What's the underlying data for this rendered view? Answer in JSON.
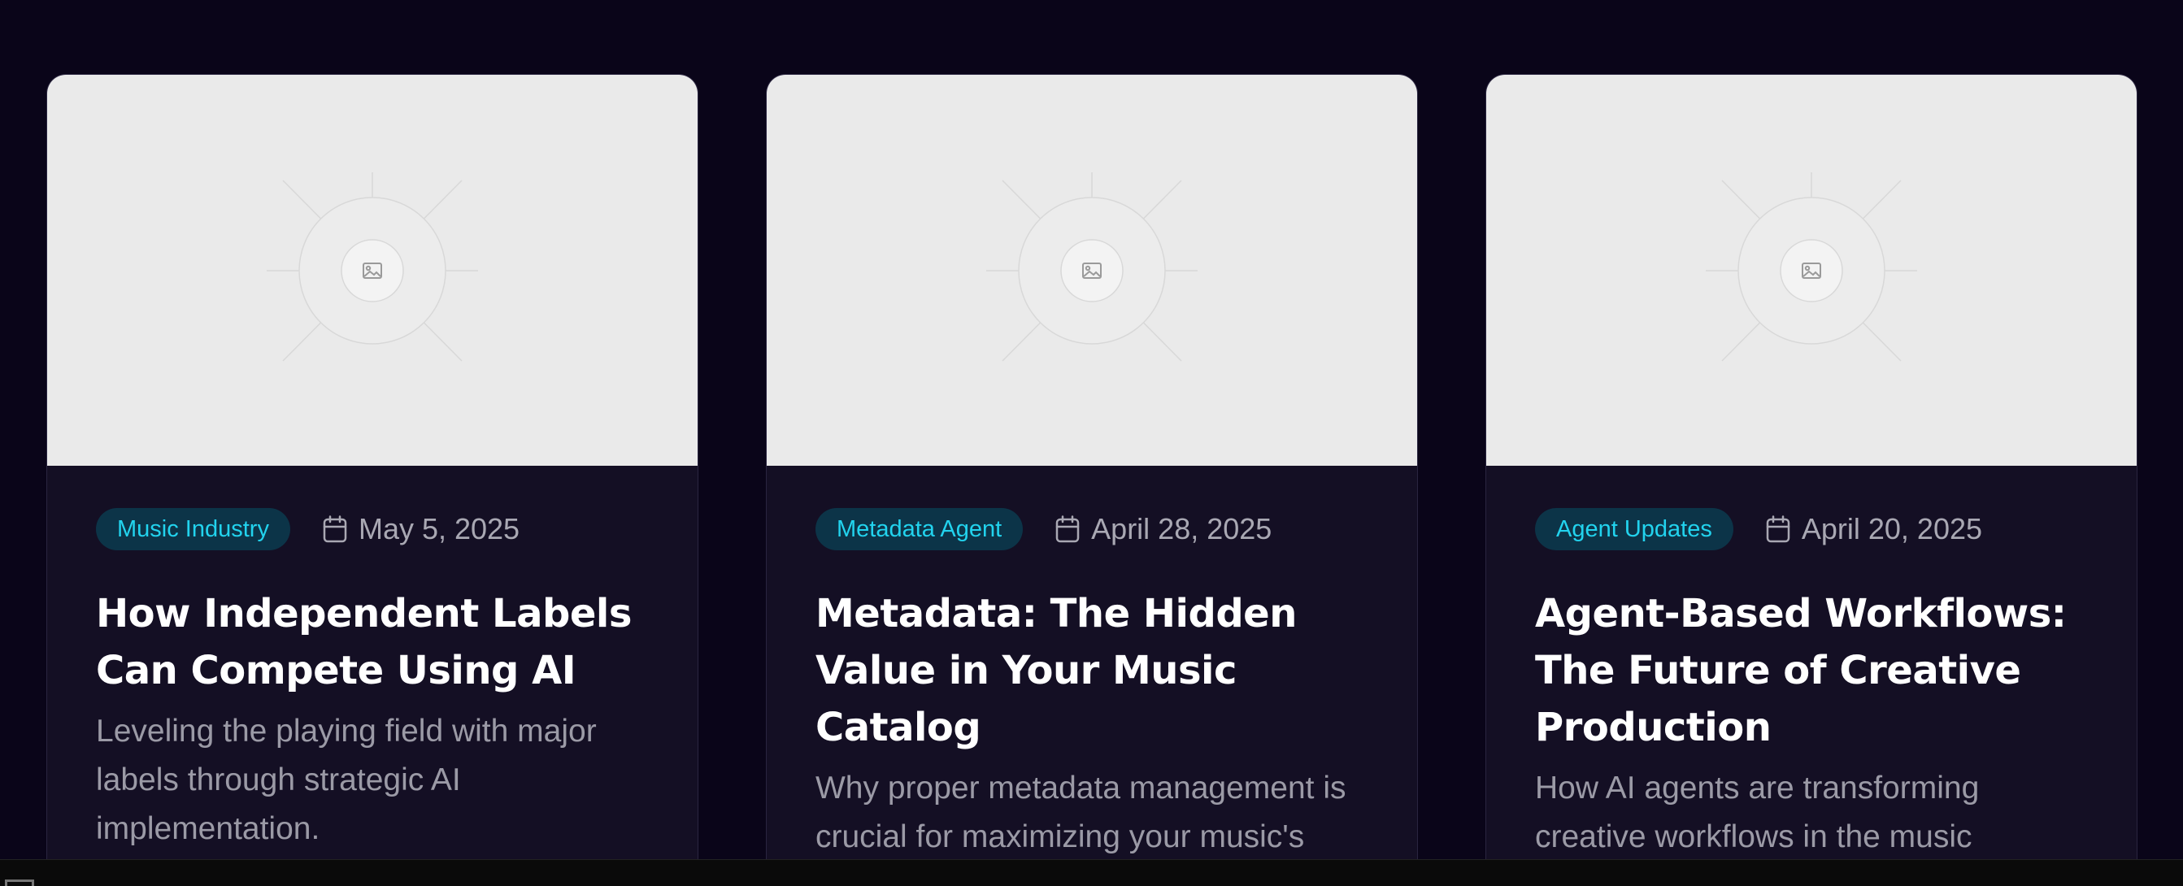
{
  "posts": [
    {
      "category": "Music Industry",
      "date": "May 5, 2025",
      "title": "How Independent Labels Can Compete Using AI",
      "excerpt": "Leveling the playing field with major labels through strategic AI implementation.",
      "image_icon": "image-placeholder-icon",
      "date_icon": "calendar-icon"
    },
    {
      "category": "Metadata Agent",
      "date": "April 28, 2025",
      "title": "Metadata: The Hidden Value in Your Music Catalog",
      "excerpt": "Why proper metadata management is crucial for maximizing your music's potential.",
      "image_icon": "image-placeholder-icon",
      "date_icon": "calendar-icon"
    },
    {
      "category": "Agent Updates",
      "date": "April 20, 2025",
      "title": "Agent-Based Workflows: The Future of Creative Production",
      "excerpt": "How AI agents are transforming creative workflows in the music",
      "image_icon": "image-placeholder-icon",
      "date_icon": "calendar-icon"
    }
  ],
  "colors": {
    "page_background": "#0a0519",
    "card_background": "#140f24",
    "tag_background": "#0c3448",
    "tag_text": "#22d3ee",
    "title_text": "#ffffff",
    "muted_text": "#a9a8b3",
    "image_placeholder": "#eaeaea"
  }
}
